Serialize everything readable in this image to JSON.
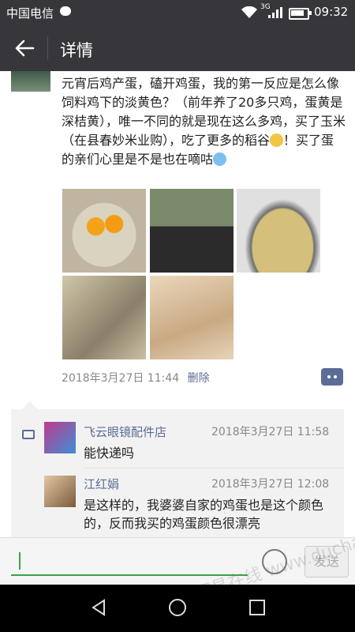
{
  "status_bar": {
    "carrier": "中国电信",
    "network": "3G",
    "time": "09:32"
  },
  "title_bar": {
    "title": "详情"
  },
  "post": {
    "text_part1": "元宵后鸡产蛋，磕开鸡蛋，我的第一反应是怎么像饲料鸡下的淡黄色？（前年养了20多只鸡，蛋黄是深桔黄），唯一不同的就是现在这么多鸡，买了玉米（在县春妙米业购），吃了更多的稻谷",
    "text_part2": "！买了蛋的亲们心里是不是也在嘀咕",
    "emojis": [
      "smile-emoji",
      "cry-emoji"
    ],
    "timestamp": "2018年3月27日 11:44",
    "delete_label": "删除",
    "photos": [
      "egg-yolks-photo",
      "chickens-photo",
      "grain-bucket-photo",
      "feed-photo",
      "grain-sacks-photo"
    ]
  },
  "comments": [
    {
      "name": "飞云眼镜配件店",
      "time": "2018年3月27日 11:58",
      "text": "能快递吗"
    },
    {
      "name": "江红娟",
      "time": "2018年3月27日 12:08",
      "text": "是这样的，我婆婆自家的鸡蛋也是这个颜色的，反而我买的鸡蛋颜色很漂亮"
    }
  ],
  "input_bar": {
    "send_label": "发送"
  },
  "watermark": "都昌在线 www.duchang.org",
  "colors": {
    "header_bg": "#37373b",
    "link_blue": "#5b6d96",
    "input_green": "#3aa24a"
  }
}
